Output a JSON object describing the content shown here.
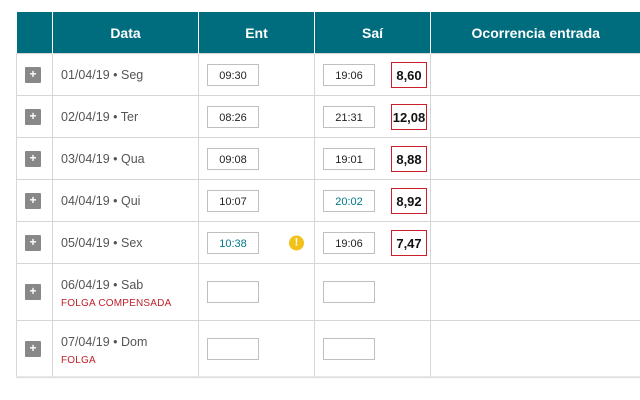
{
  "table": {
    "headers": {
      "data": "Data",
      "ent": "Ent",
      "sai": "Saí",
      "ocorrencia": "Ocorrencia entrada"
    },
    "rows": [
      {
        "expand": "+",
        "date": "01/04/19 • Seg",
        "sub": "",
        "ent": "09:30",
        "ent_highlight": false,
        "ent_warning": false,
        "sai": "19:06",
        "sai_highlight": false,
        "total": "8,60"
      },
      {
        "expand": "+",
        "date": "02/04/19 • Ter",
        "sub": "",
        "ent": "08:26",
        "ent_highlight": false,
        "ent_warning": false,
        "sai": "21:31",
        "sai_highlight": false,
        "total": "12,08"
      },
      {
        "expand": "+",
        "date": "03/04/19 • Qua",
        "sub": "",
        "ent": "09:08",
        "ent_highlight": false,
        "ent_warning": false,
        "sai": "19:01",
        "sai_highlight": false,
        "total": "8,88"
      },
      {
        "expand": "+",
        "date": "04/04/19 • Qui",
        "sub": "",
        "ent": "10:07",
        "ent_highlight": false,
        "ent_warning": false,
        "sai": "20:02",
        "sai_highlight": true,
        "total": "8,92"
      },
      {
        "expand": "+",
        "date": "05/04/19 • Sex",
        "sub": "",
        "ent": "10:38",
        "ent_highlight": true,
        "ent_warning": true,
        "warning_icon": "!",
        "sai": "19:06",
        "sai_highlight": false,
        "total": "7,47"
      },
      {
        "expand": "+",
        "date": "06/04/19 • Sab",
        "sub": "FOLGA COMPENSADA",
        "ent": "",
        "ent_highlight": false,
        "ent_warning": false,
        "sai": "",
        "sai_highlight": false,
        "total": ""
      },
      {
        "expand": "+",
        "date": "07/04/19 • Dom",
        "sub": "FOLGA",
        "ent": "",
        "ent_highlight": false,
        "ent_warning": false,
        "sai": "",
        "sai_highlight": false,
        "total": ""
      }
    ]
  },
  "colors": {
    "header_bg": "#006d7e",
    "highlight_text": "#007a8a",
    "total_border": "#cc1d2a",
    "sub_text": "#c0202a",
    "warning": "#f2c11a"
  },
  "icons": {
    "expand": "plus-icon",
    "warning": "warning-icon"
  }
}
